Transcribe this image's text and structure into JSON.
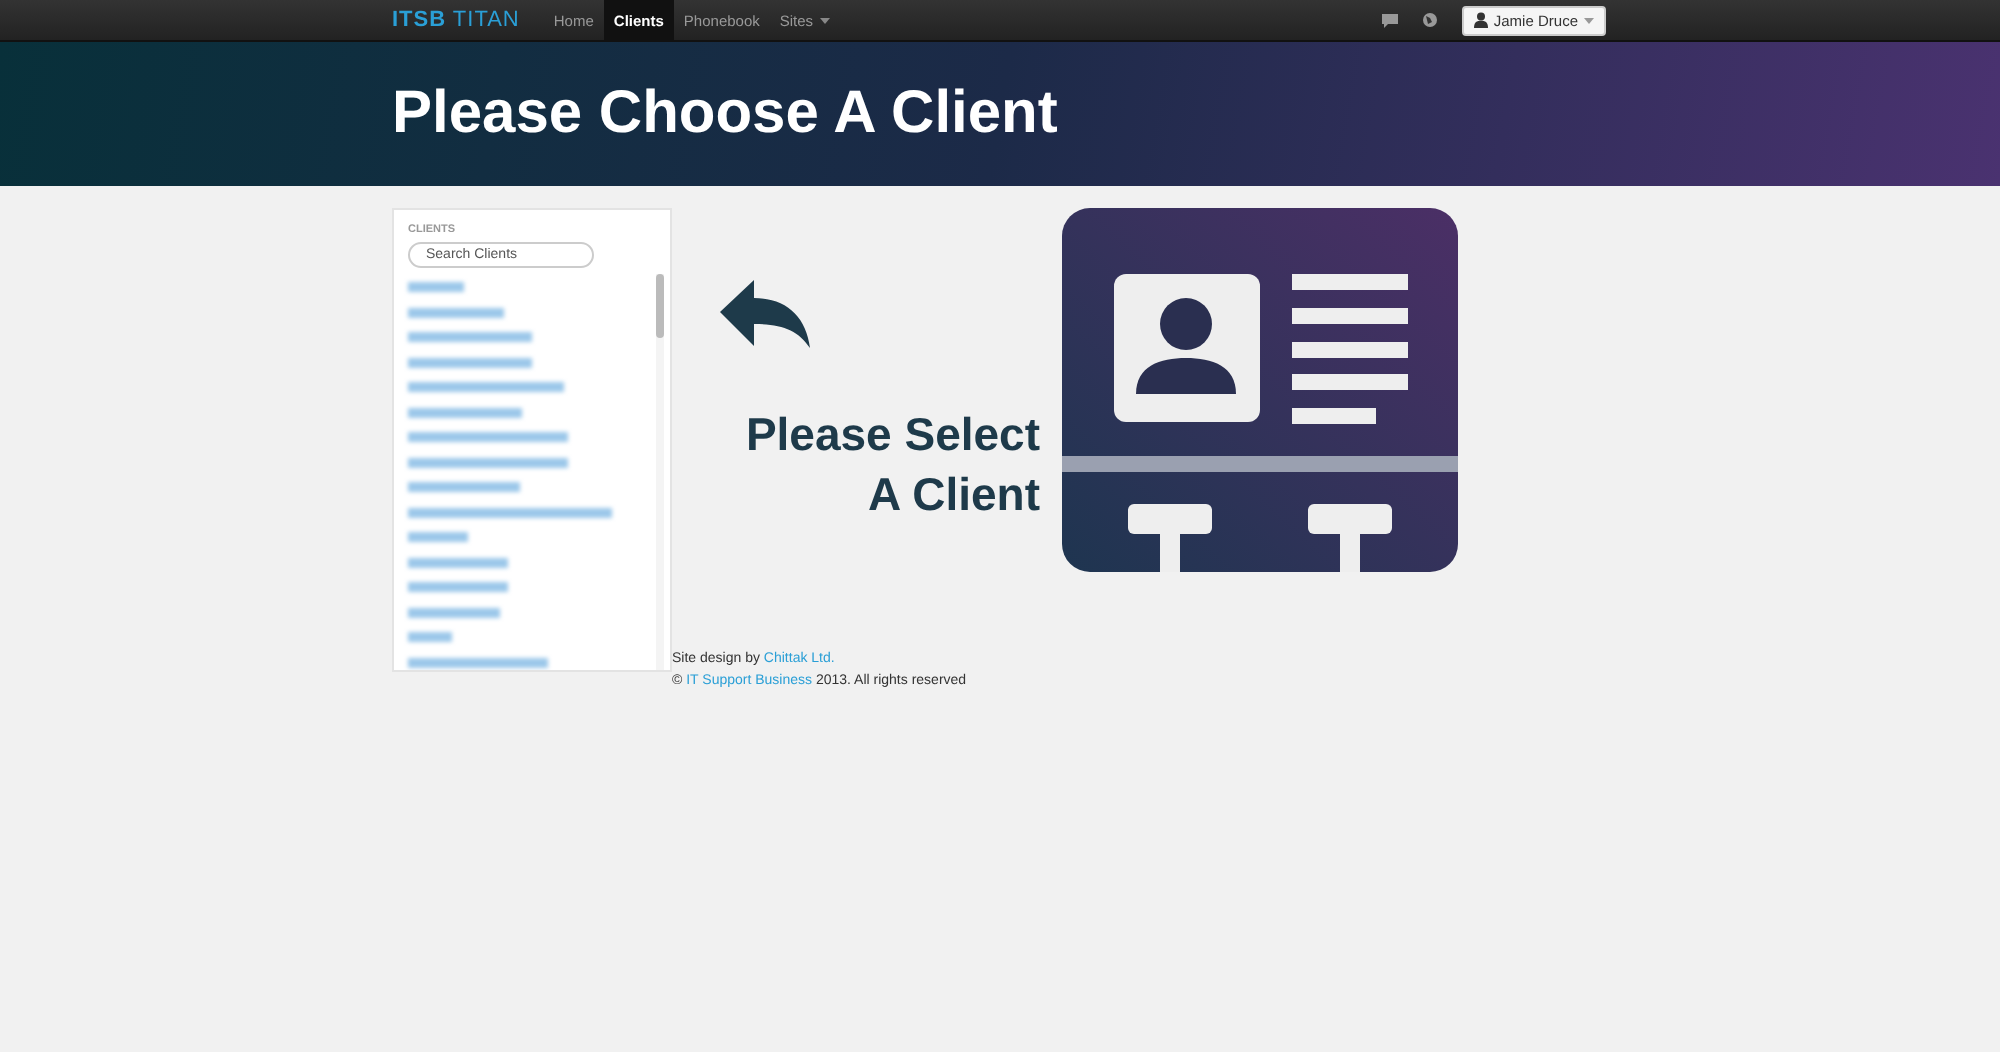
{
  "navbar": {
    "brand": {
      "part_1": "ITSB",
      "part_2": "TITAN"
    },
    "links": [
      {
        "label": "Home",
        "selected": false,
        "dropdown": false
      },
      {
        "label": "Clients",
        "selected": true,
        "dropdown": false
      },
      {
        "label": "Phonebook",
        "selected": false,
        "dropdown": false
      },
      {
        "label": "Sites",
        "selected": false,
        "dropdown": true
      }
    ],
    "user": "Jamie Druce"
  },
  "banner": {
    "title": "Please Choose A Client"
  },
  "sidebar": {
    "heading": "CLIENTS",
    "search": {
      "placeholder": "Search Clients"
    }
  },
  "prompt": {
    "line_1": "Please Select",
    "line_2": "A Client"
  },
  "footer": {
    "line_1": {
      "text": "Site design by",
      "link": "Chittak Ltd."
    },
    "line_2": {
      "prefix": "©",
      "link": "IT Support Business",
      "text": "2013. All rights reserved"
    }
  }
}
